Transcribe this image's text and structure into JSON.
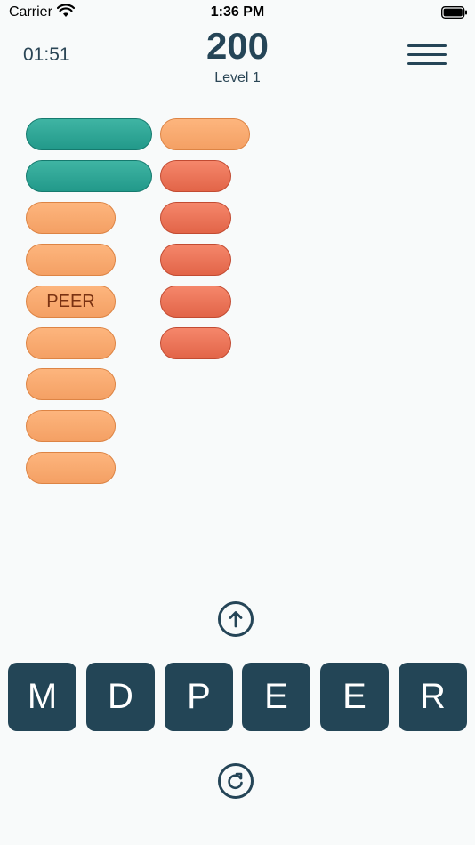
{
  "status": {
    "carrier": "Carrier",
    "time": "1:36 PM"
  },
  "header": {
    "timer": "01:51",
    "score": "200",
    "level": "Level 1"
  },
  "word_slots": [
    {
      "state": "found",
      "text": ""
    },
    {
      "state": "found",
      "text": ""
    },
    {
      "state": "empty",
      "text": ""
    },
    {
      "state": "empty",
      "text": ""
    },
    {
      "state": "hint",
      "text": "PEER"
    },
    {
      "state": "empty",
      "text": ""
    },
    {
      "state": "empty",
      "text": ""
    },
    {
      "state": "empty",
      "text": ""
    },
    {
      "state": "empty",
      "text": ""
    },
    {
      "state": "empty",
      "text": ""
    },
    {
      "state": "bonus",
      "text": ""
    },
    {
      "state": "bonus",
      "text": ""
    },
    {
      "state": "bonus",
      "text": ""
    },
    {
      "state": "bonus",
      "text": ""
    },
    {
      "state": "bonus",
      "text": ""
    }
  ],
  "letter_tiles": [
    "M",
    "D",
    "P",
    "E",
    "E",
    "R"
  ],
  "colors": {
    "found": "#2aa394",
    "empty": "#f9a96e",
    "bonus": "#ec7557",
    "tile": "#234556"
  },
  "icons": {
    "submit": "arrow-up-circle-icon",
    "shuffle": "refresh-circle-icon",
    "menu": "hamburger-menu-icon"
  }
}
